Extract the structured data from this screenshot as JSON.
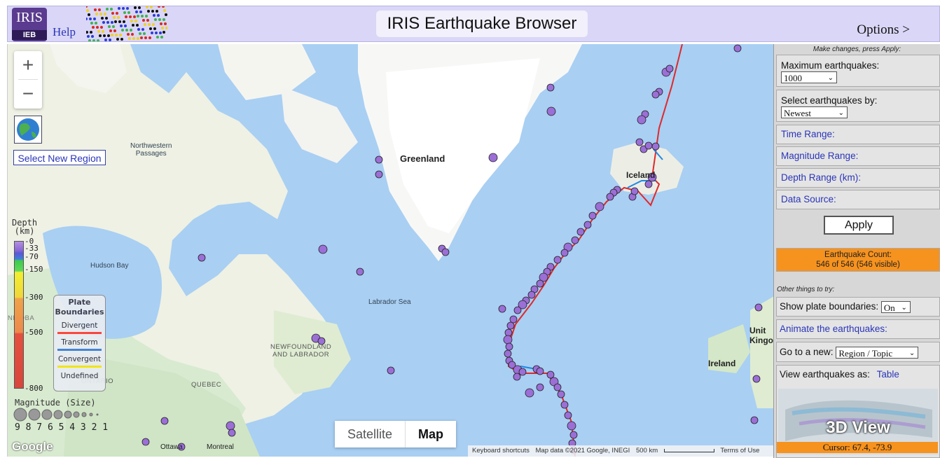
{
  "header": {
    "logo_top": "IRIS",
    "logo_bottom": "IEB",
    "help_label": "Help",
    "title": "IRIS Earthquake Browser",
    "options_label": "Options >"
  },
  "map": {
    "zoom_in": "+",
    "zoom_out": "−",
    "select_region_label": "Select New Region",
    "labels": {
      "greenland": "Greenland",
      "iceland": "Iceland",
      "northwestern_passages": "Northwestern\nPassages",
      "hudson_bay": "Hudson Bay",
      "labrador_sea": "Labrador Sea",
      "newfoundland": "NEWFOUNDLAND\nAND LABRADOR",
      "quebec": "QUEBEC",
      "ontario": "ONTARIO",
      "manitoba": "NITOBA",
      "ireland": "Ireland",
      "united_kingdom": "Unit\nKingo",
      "ottawa": "Ottawa",
      "montreal": "Montreal"
    },
    "depth_legend": {
      "title": "Depth\n(km)",
      "ticks": [
        "0",
        "33",
        "70",
        "150",
        "300",
        "500",
        "800"
      ]
    },
    "plate_legend": {
      "title": "Plate\nBoundaries",
      "items": [
        {
          "label": "Divergent",
          "color": "#ff3b30"
        },
        {
          "label": "Transform",
          "color": "#3a7bd5"
        },
        {
          "label": "Convergent",
          "color": "#f5e400"
        },
        {
          "label": "Undefined",
          "color": ""
        }
      ]
    },
    "magnitude_legend": {
      "title": "Magnitude (Size)",
      "values": "9 8 7 6 5 4 3 2 1"
    },
    "google_logo": "Google",
    "map_type": {
      "satellite": "Satellite",
      "map": "Map",
      "active": "Map"
    },
    "footer": {
      "shortcuts": "Keyboard shortcuts",
      "attribution": "Map data ©2021 Google, INEGI",
      "scale": "500 km",
      "terms": "Terms of Use"
    },
    "event_color": "#9b6fd6",
    "divergent_color": "#e0282a",
    "transform_color": "#1e88e5"
  },
  "panel": {
    "note": "Make changes, press Apply:",
    "max_quakes_label": "Maximum earthquakes:",
    "max_quakes_value": "1000",
    "select_by_label": "Select earthquakes by:",
    "select_by_value": "Newest",
    "time_range": "Time Range:",
    "magnitude_range": "Magnitude Range:",
    "depth_range": "Depth Range (km):",
    "data_source": "Data Source:",
    "apply_label": "Apply",
    "count_title": "Earthquake Count:",
    "count_value": "546 of 546 (546 visible)",
    "other_label": "Other things to try:",
    "plate_boundaries_label": "Show plate boundaries:",
    "plate_boundaries_value": "On",
    "animate_label": "Animate the earthquakes:",
    "goto_label": "Go to a new:",
    "goto_value": "Region / Topic",
    "view_as_label": "View earthquakes as:",
    "view_as_link": "Table",
    "view3d_label": "3D View",
    "cursor_text": "Cursor: 67.4, -73.9"
  }
}
